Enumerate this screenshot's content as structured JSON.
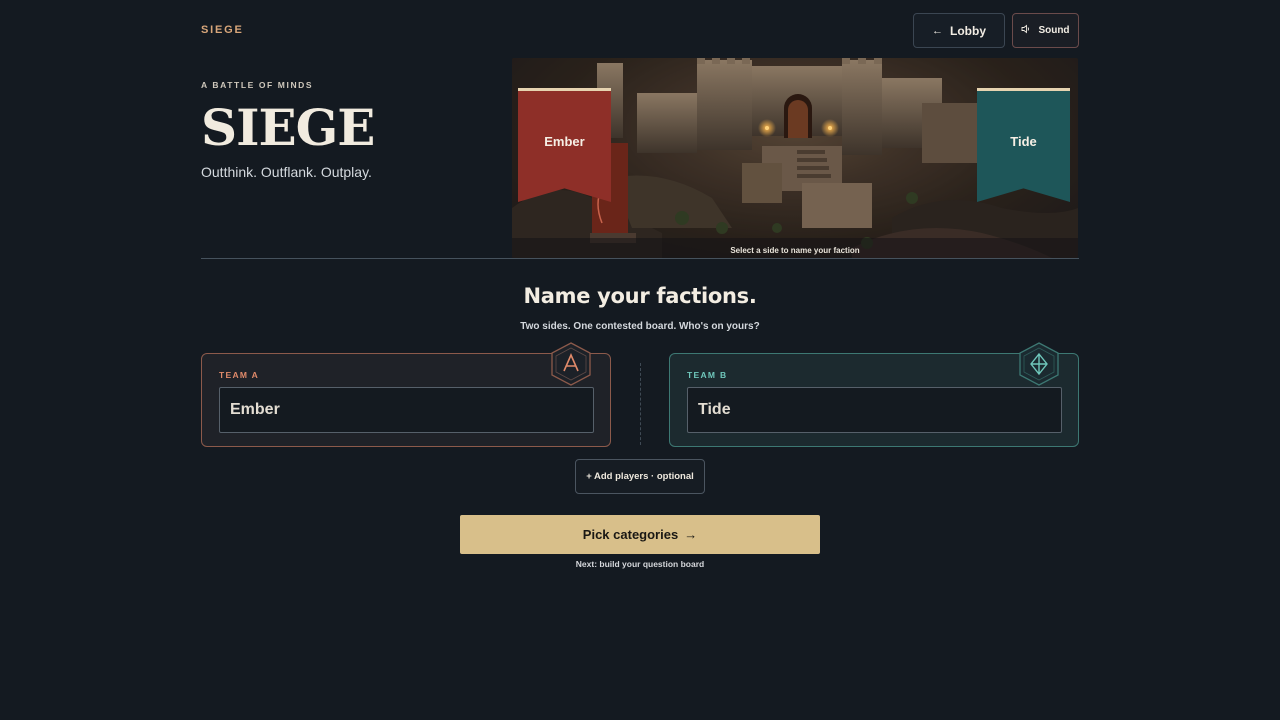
{
  "header": {
    "brand": "SIEGE",
    "lobby_label": "Lobby",
    "sound_label": "Sound"
  },
  "hero": {
    "eyebrow": "A BATTLE OF MINDS",
    "title": "SIEGE",
    "tagline": "Outthink. Outflank. Outplay.",
    "banner_left": "Ember",
    "banner_right": "Tide",
    "caption": "Select a side to name your faction"
  },
  "factions": {
    "title": "Name your factions.",
    "subtitle": "Two sides. One contested board. Who's on yours?",
    "team_a": {
      "label": "TEAM A",
      "value": "Ember",
      "crest_icon": "letter-a-crest-icon",
      "accent": "#e08a6a"
    },
    "team_b": {
      "label": "TEAM B",
      "value": "Tide",
      "crest_icon": "diamond-crest-icon",
      "accent": "#6fc7bb"
    },
    "add_players_label": "+ Add players · optional"
  },
  "cta": {
    "label": "Pick categories",
    "hint": "Next: build your question board"
  },
  "colors": {
    "background": "#141a21",
    "gold": "#d8bf8a",
    "ember": "#8e2f28",
    "tide": "#1e5659"
  }
}
